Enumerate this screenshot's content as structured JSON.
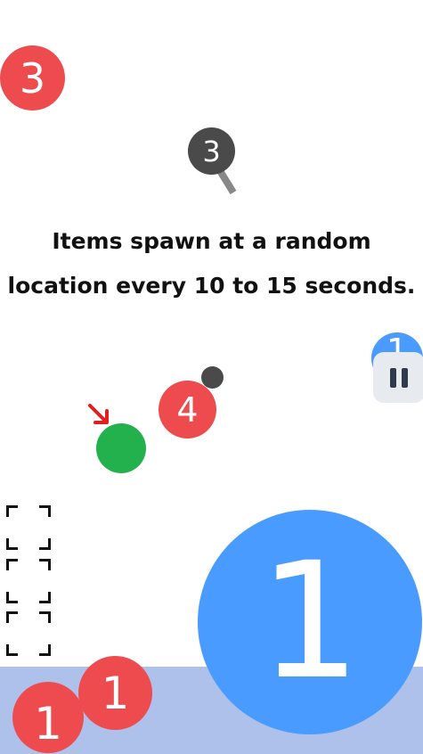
{
  "tutorial": {
    "line1": "Items spawn at a random",
    "line2": "location every 10 to 15 seconds."
  },
  "items": {
    "top_left_counter": "3",
    "magnifier_counter": "3",
    "right_edge_counter": "1",
    "near_player_counter": "4",
    "big_counter": "1",
    "bottom_left_counter": "1",
    "bottom_mid_counter": "1"
  },
  "icons": {
    "pause": "pause-icon",
    "arrow": "arrow-down-right-icon",
    "magnifier": "magnifier-icon",
    "inventory_slot": "corner-bracket-icon"
  },
  "colors": {
    "red_item": "#ee4b4f",
    "blue_item": "#4a9bff",
    "player": "#22b14c",
    "ground": "#aec1ea",
    "arrow": "#e02020",
    "pause_bg": "#e7eaef"
  }
}
